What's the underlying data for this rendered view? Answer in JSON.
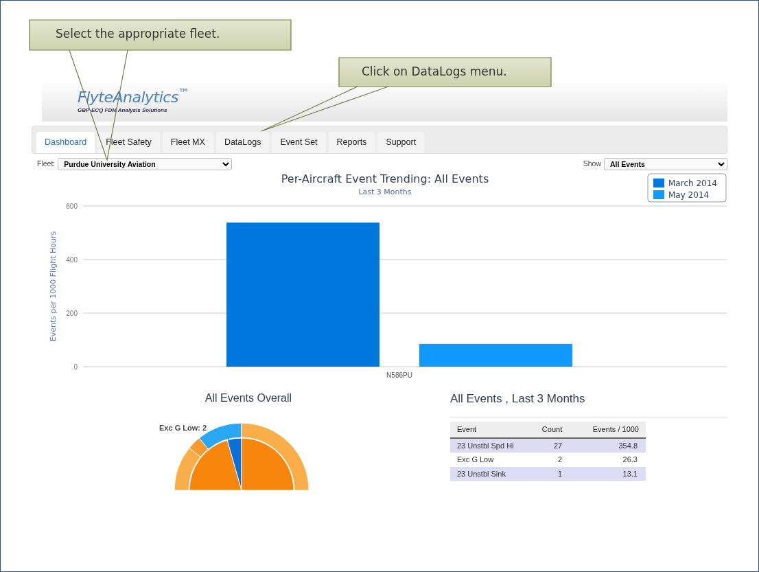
{
  "callouts": [
    {
      "text": "Select the appropriate fleet."
    },
    {
      "text": "Click on DataLogs menu."
    }
  ],
  "header": {
    "logo": "FlyteAnalytics$^{™}$",
    "tagline": "GBP·ECQ FDM Analysis Solutions"
  },
  "tabs": [
    {
      "label": "Dashboard",
      "selected": true
    },
    {
      "label": "Fleet Safety",
      "selected": false
    },
    {
      "label": "Fleet MX",
      "selected": false
    },
    {
      "label": "DataLogs",
      "selected": false
    },
    {
      "label": "Event Set",
      "selected": false
    },
    {
      "label": "Reports",
      "selected": false
    },
    {
      "label": "Support",
      "selected": false
    }
  ],
  "filters": {
    "fleet": {
      "label": "Fleet:",
      "value": "Purdue University Aviation"
    },
    "show": {
      "label": "Show",
      "value": "All Events"
    }
  },
  "trend_chart": {
    "chart_data": {
      "type": "bar",
      "title": "Per-Aircraft Event Trending: All Events",
      "subtitle": "Last 3 Months",
      "ylabel": "Events per 1000 Flight Hours",
      "categories": [
        "N586PU"
      ],
      "legend": "top-right",
      "ylim": [
        0,
        600
      ],
      "yticks": [
        0,
        200,
        400,
        600
      ],
      "series": [
        {
          "name": "March 2014",
          "color": "#0077dd",
          "values": [
            538
          ]
        },
        {
          "name": "May 2014",
          "color": "#1199ff",
          "values": [
            85
          ]
        }
      ]
    }
  },
  "overall": {
    "title": "All Events Overall",
    "label": "Exc G Low:  2"
  },
  "events_table": {
    "title": "All Events , Last 3 Months",
    "columns": [
      "Event",
      "Count",
      "Events / 1000"
    ],
    "rows": [
      [
        "23 Unstbl Spd Hi",
        "27",
        "354.8"
      ],
      [
        "Exc G Low",
        "2",
        "26.3"
      ],
      [
        "23 Unstbl Sink",
        "1",
        "13.1"
      ]
    ]
  }
}
